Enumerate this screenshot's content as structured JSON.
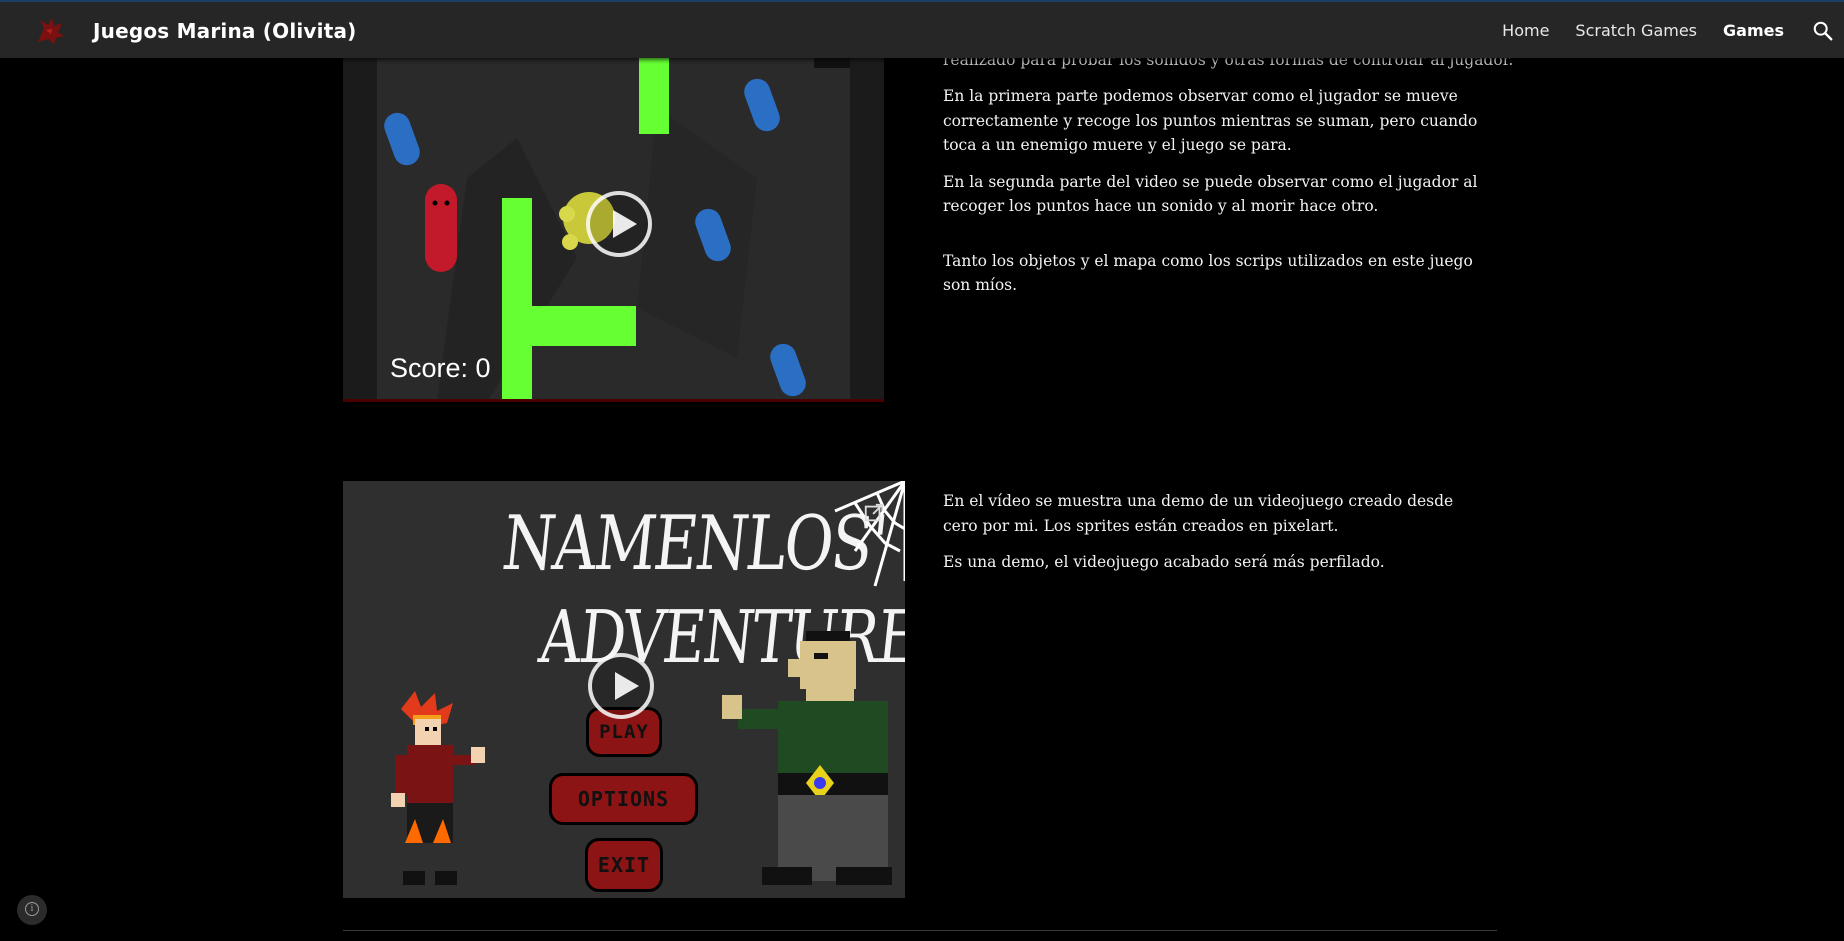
{
  "header": {
    "site_title": "Juegos Marina (Olivita)",
    "nav": [
      "Home",
      "Scratch Games",
      "Games"
    ],
    "active_nav": "Games",
    "search_icon": "search-icon",
    "logo_icon": "dragon-logo-icon"
  },
  "section1": {
    "cut_line": "realizado para probar los sonidos y otras formas de controlar al jugador.",
    "paragraphs": [
      "En la primera parte podemos observar como el jugador se mueve correctamente y recoge los puntos mientras se suman, pero cuando toca a un enemigo muere y el juego se para.",
      "En la segunda parte del video se puede observar como el jugador al recoger los puntos hace un sonido y al morir hace otro.",
      "Tanto los objetos y el mapa como los scrips utilizados en este juego son míos."
    ],
    "video": {
      "score_label": "Score: 0"
    }
  },
  "section2": {
    "paragraphs": [
      "En el vídeo se muestra una demo de un videojuego creado desde cero por mi. Los sprites están creados en pixelart.",
      "Es una demo, el videojuego acabado será más perfilado."
    ],
    "video": {
      "title_line1": "NAMENLOS'",
      "title_line2": "ADVENTURE",
      "buttons": [
        "PLAY",
        "OPTIONS",
        "EXIT"
      ]
    }
  },
  "colors": {
    "header_bg": "#262626",
    "page_bg": "#000000",
    "accent_green": "#66ff33",
    "enemy_blue": "#2a6fc4",
    "button_red": "#8c1414"
  }
}
